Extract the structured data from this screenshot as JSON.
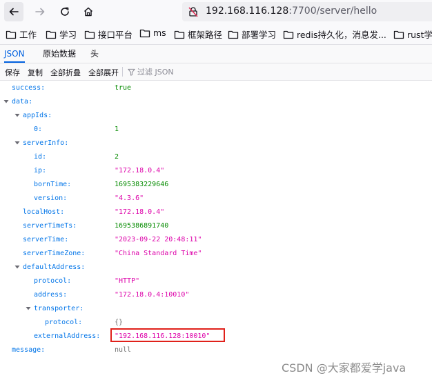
{
  "browser": {
    "url_host": "192.168.116.128",
    "url_rest": ":7700/server/hello",
    "icons": [
      "back-arrow-icon",
      "forward-arrow-icon",
      "reload-icon",
      "home-icon",
      "not-secure-lock-icon",
      "folder-icon"
    ]
  },
  "bookmarks": [
    "工作",
    "学习",
    "接口平台",
    "ms",
    "框架路径",
    "部署学习",
    "redis持久化，消息发...",
    "rust学习"
  ],
  "tabs": [
    "JSON",
    "原始数据",
    "头"
  ],
  "toolbar": {
    "save": "保存",
    "copy": "复制",
    "collapse_all": "全部折叠",
    "expand_all": "全部展开",
    "filter_placeholder": "过滤 JSON"
  },
  "json_rows": [
    {
      "key": "success:",
      "val": "true",
      "type": "bool",
      "depth": 0,
      "toggle": false
    },
    {
      "key": "data:",
      "val": "",
      "type": "",
      "depth": 0,
      "toggle": true
    },
    {
      "key": "appIds:",
      "val": "",
      "type": "",
      "depth": 1,
      "toggle": true
    },
    {
      "key": "0:",
      "val": "1",
      "type": "num",
      "depth": 2,
      "toggle": false
    },
    {
      "key": "serverInfo:",
      "val": "",
      "type": "",
      "depth": 1,
      "toggle": true
    },
    {
      "key": "id:",
      "val": "2",
      "type": "num",
      "depth": 2,
      "toggle": false
    },
    {
      "key": "ip:",
      "val": "\"172.18.0.4\"",
      "type": "str",
      "depth": 2,
      "toggle": false
    },
    {
      "key": "bornTime:",
      "val": "1695383229646",
      "type": "num",
      "depth": 2,
      "toggle": false
    },
    {
      "key": "version:",
      "val": "\"4.3.6\"",
      "type": "str",
      "depth": 2,
      "toggle": false
    },
    {
      "key": "localHost:",
      "val": "\"172.18.0.4\"",
      "type": "str",
      "depth": 1,
      "toggle": false
    },
    {
      "key": "serverTimeTs:",
      "val": "1695386891740",
      "type": "num",
      "depth": 1,
      "toggle": false
    },
    {
      "key": "serverTime:",
      "val": "\"2023-09-22 20:48:11\"",
      "type": "str",
      "depth": 1,
      "toggle": false
    },
    {
      "key": "serverTimeZone:",
      "val": "\"China Standard Time\"",
      "type": "str",
      "depth": 1,
      "toggle": false
    },
    {
      "key": "defaultAddress:",
      "val": "",
      "type": "",
      "depth": 1,
      "toggle": true
    },
    {
      "key": "protocol:",
      "val": "\"HTTP\"",
      "type": "str",
      "depth": 2,
      "toggle": false
    },
    {
      "key": "address:",
      "val": "\"172.18.0.4:10010\"",
      "type": "str",
      "depth": 2,
      "toggle": false
    },
    {
      "key": "transporter:",
      "val": "",
      "type": "",
      "depth": 2,
      "toggle": true
    },
    {
      "key": "protocol:",
      "val": "{}",
      "type": "obj",
      "depth": 3,
      "toggle": false
    },
    {
      "key": "externalAddress:",
      "val": "\"192.168.116.128:10010\"",
      "type": "str",
      "depth": 2,
      "toggle": false
    },
    {
      "key": "message:",
      "val": "null",
      "type": "nul",
      "depth": 0,
      "toggle": false
    }
  ],
  "highlight_color": "#e0201a",
  "watermark": "CSDN @大家都爱学java"
}
